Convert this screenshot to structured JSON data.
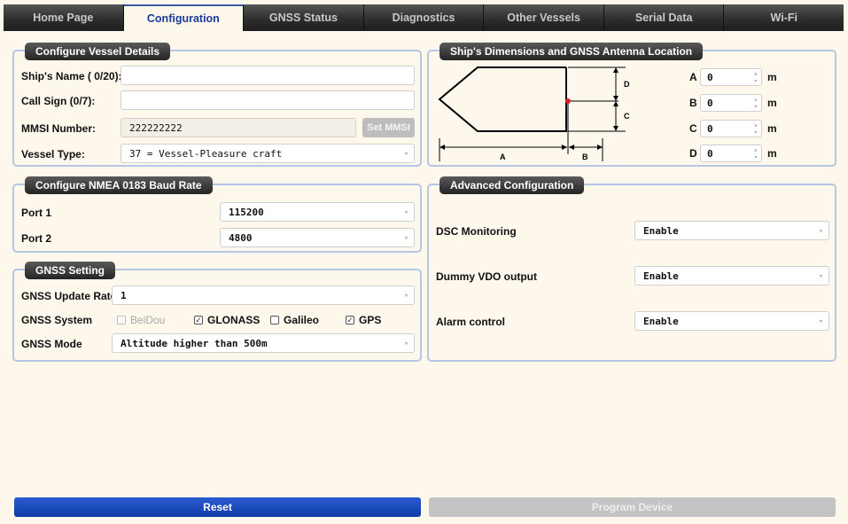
{
  "tabs": [
    {
      "label": "Home Page",
      "active": false
    },
    {
      "label": "Configuration",
      "active": true
    },
    {
      "label": "GNSS Status",
      "active": false
    },
    {
      "label": "Diagnostics",
      "active": false
    },
    {
      "label": "Other Vessels",
      "active": false
    },
    {
      "label": "Serial Data",
      "active": false
    },
    {
      "label": "Wi-Fi",
      "active": false
    }
  ],
  "vessel": {
    "title": "Configure Vessel Details",
    "ship_name_label": "Ship's Name  ( 0/20):",
    "ship_name_value": "",
    "call_sign_label": "Call Sign  (0/7):",
    "call_sign_value": "",
    "mmsi_label": "MMSI Number:",
    "mmsi_value": "222222222",
    "set_mmsi_label": "Set MMSI",
    "vessel_type_label": "Vessel Type:",
    "vessel_type_value": "37 = Vessel-Pleasure craft"
  },
  "baud": {
    "title": "Configure NMEA 0183 Baud Rate",
    "port1_label": "Port 1",
    "port1_value": "115200",
    "port2_label": "Port 2",
    "port2_value": "4800"
  },
  "gnss": {
    "title": "GNSS Setting",
    "update_rate_label": "GNSS Update Rate",
    "update_rate_value": "1",
    "system_label": "GNSS System",
    "systems": [
      {
        "label": "BeiDou",
        "checked": false,
        "disabled": true
      },
      {
        "label": "GLONASS",
        "checked": true,
        "disabled": false
      },
      {
        "label": "Galileo",
        "checked": false,
        "disabled": false
      },
      {
        "label": "GPS",
        "checked": true,
        "disabled": false
      }
    ],
    "mode_label": "GNSS Mode",
    "mode_value": "Altitude higher than 500m"
  },
  "dimensions": {
    "title": "Ship's Dimensions and GNSS Antenna Location",
    "diagram_labels": {
      "a": "A",
      "b": "B",
      "c": "C",
      "d": "D"
    },
    "fields": [
      {
        "label": "A",
        "value": "0",
        "unit": "m"
      },
      {
        "label": "B",
        "value": "0",
        "unit": "m"
      },
      {
        "label": "C",
        "value": "0",
        "unit": "m"
      },
      {
        "label": "D",
        "value": "0",
        "unit": "m"
      }
    ],
    "antenna_color": "#e02020"
  },
  "advanced": {
    "title": "Advanced Configuration",
    "dsc_label": "DSC Monitoring",
    "dsc_value": "Enable",
    "vdo_label": "Dummy VDO output",
    "vdo_value": "Enable",
    "alarm_label": "Alarm control",
    "alarm_value": "Enable"
  },
  "actions": {
    "reset_label": "Reset",
    "program_label": "Program Device"
  },
  "icons": {
    "dropdown": "▿",
    "spin": "▵▿",
    "check": "✓"
  }
}
